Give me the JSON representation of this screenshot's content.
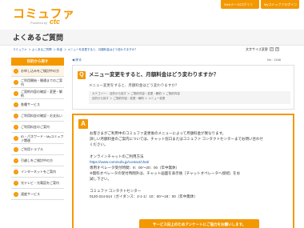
{
  "header": {
    "logo_main": "コミュファ",
    "logo_sub": "Powered by",
    "logo_brand": "ctc",
    "btn_mail": "Webメールログイン",
    "btn_mypage": "Myコミュファログイン"
  },
  "page": {
    "title": "よくあるご質問"
  },
  "breadcrumb": {
    "items": [
      "コミュファ",
      "＞ よくあるご質問",
      "＞ 料金",
      "＞ メニューを変更すると、月額料金はどう変わりますか？"
    ]
  },
  "font_size": {
    "label": "文字サイズ変更",
    "small": "小",
    "large": "大"
  },
  "sidebar": {
    "heading": "目的から探す",
    "items": [
      {
        "label": "お申し込みをご検討中の方",
        "active": true
      },
      {
        "label": "ご利用開始・開通までのご案内"
      },
      {
        "label": "ご契約内容の確認・変更・解約"
      },
      {
        "label": "各種サービス"
      },
      {
        "label": "ご利用料金の確認・お支払い"
      },
      {
        "label": "ご利用料金のご案内"
      },
      {
        "label": "ID・パスワード・Myコミュファ関連"
      },
      {
        "label": "ご利用トラブル"
      },
      {
        "label": "引越しをご検討中の方"
      },
      {
        "label": "インターネットをご案内"
      },
      {
        "label": "光テレビ・光電話をご案内"
      },
      {
        "label": "速度サービス"
      }
    ]
  },
  "question": {
    "mark": "Q",
    "title": "メニュー変更をすると、月額料金はどう変わりますか？",
    "restated": "メニュー変更をすると、月額料金はどう変わりますか？",
    "faq_no": "No : 1166",
    "categories": [
      "カテゴリー： 目的から探す ＞ ご契約内容・変更・解約 ＞ ご契約内容",
      "目的から探す ＞ ご契約内容・変更・解約 ＞ メニュー変更"
    ],
    "back": "◀ 戻る"
  },
  "answer": {
    "mark": "A",
    "lines": [
      "お客さまがご利用中のコミュファ変更後のメニューによって月額料金が異なります。",
      "詳しい月額料金のご案内については、チャット窓口またはコミュファ コンタクトセンターまでお問い合わせ",
      "ください。",
      "",
      "オンラインチャットのご利用方法",
      "https://www.commufa.jp/contact/chat/",
      "専用オペレータ受付時間：9：00〜20：00（年中無休）",
      "※無料オペレータの受付時間外は、チャット画面を表示後［チャットオペレータへ接続］をお",
      "試し下さい。",
      "",
      "コミュファ コンタクトセンター",
      "0120-314-514（ガイダンス：2-1-1）10：00〜18：00（年中無休）"
    ],
    "link_line": 5,
    "phone_prefix": "0120-314-514"
  },
  "survey": {
    "label": "サービス向上のためアンケートにご協力をお願いします。"
  }
}
